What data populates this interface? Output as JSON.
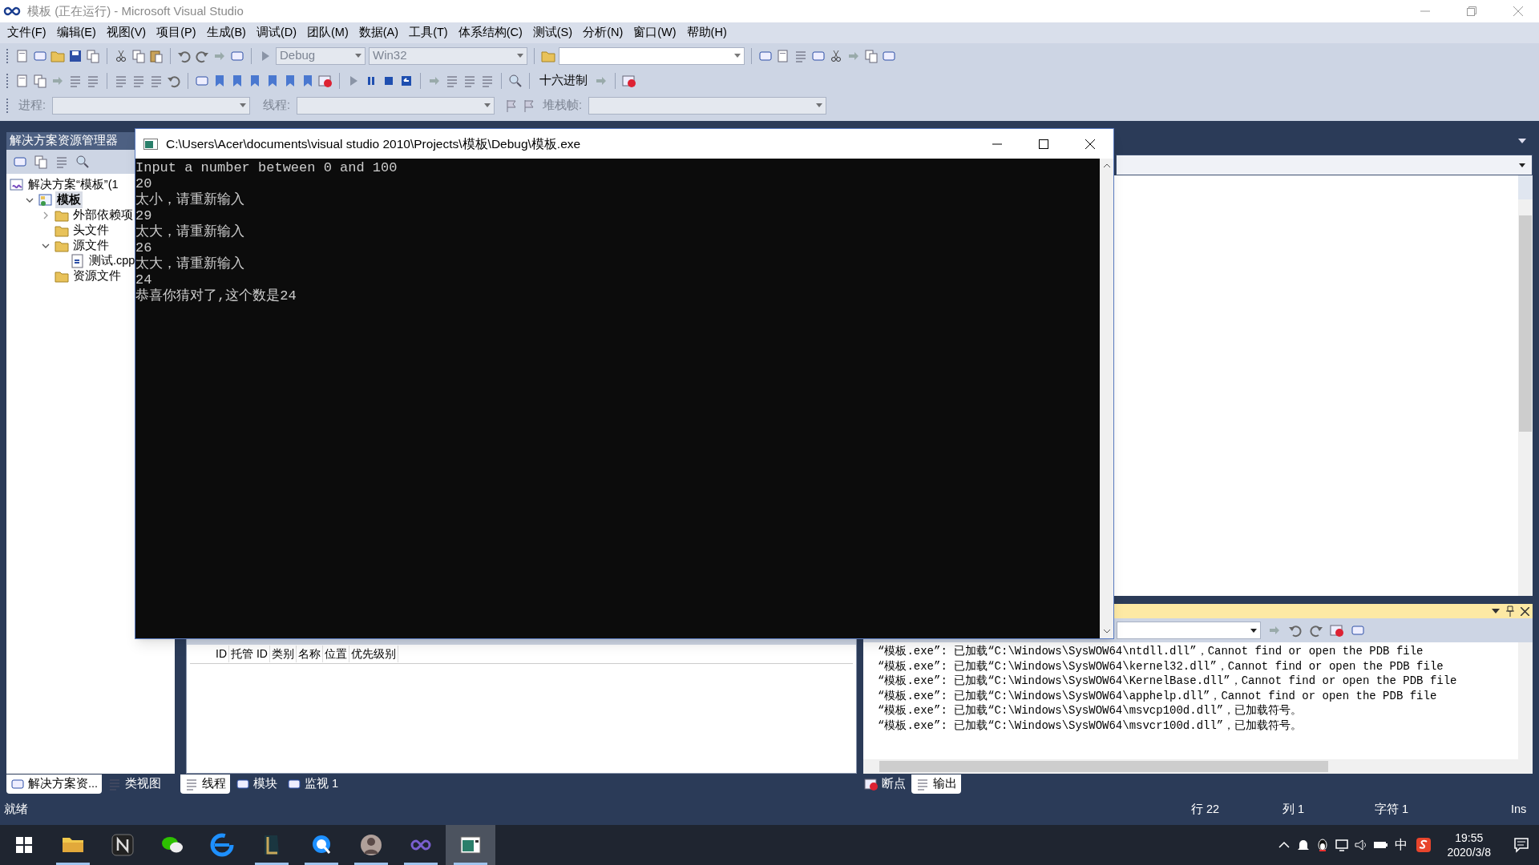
{
  "window": {
    "title": "模板 (正在运行) - Microsoft Visual Studio"
  },
  "menu": [
    "文件(F)",
    "编辑(E)",
    "视图(V)",
    "项目(P)",
    "生成(B)",
    "调试(D)",
    "团队(M)",
    "数据(A)",
    "工具(T)",
    "体系结构(C)",
    "测试(S)",
    "分析(N)",
    "窗口(W)",
    "帮助(H)"
  ],
  "toolbar": {
    "configuration": "Debug",
    "platform": "Win32",
    "hex_button": "十六进制",
    "process_label": "进程:",
    "thread_label": "线程:",
    "stack_frame_label": "堆栈帧:"
  },
  "solution_explorer": {
    "title": "解决方案资源管理器",
    "tree": [
      {
        "label": "解决方案“模板”(1",
        "kind": "solution",
        "selected": false,
        "children": [
          {
            "label": "模板",
            "kind": "project",
            "selected": true,
            "expanded": true,
            "children": [
              {
                "label": "外部依赖项",
                "kind": "folder",
                "selected": false,
                "expanded": false
              },
              {
                "label": "头文件",
                "kind": "folder",
                "selected": false
              },
              {
                "label": "源文件",
                "kind": "folder",
                "selected": false,
                "expanded": true,
                "children": [
                  {
                    "label": "测试.cpp",
                    "kind": "file",
                    "selected": false
                  }
                ]
              },
              {
                "label": "资源文件",
                "kind": "folder",
                "selected": false
              }
            ]
          }
        ]
      }
    ]
  },
  "console": {
    "title": "C:\\Users\\Acer\\documents\\visual studio 2010\\Projects\\模板\\Debug\\模板.exe",
    "lines": [
      "Input a number between 0 and 100",
      "20",
      "太小，请重新输入",
      "29",
      "太大，请重新输入",
      "26",
      "太大，请重新输入",
      "24",
      "恭喜你猜对了,这个数是24"
    ]
  },
  "threads": {
    "columns": [
      "ID",
      "托管 ID",
      "类别",
      "名称",
      "位置",
      "优先级别"
    ]
  },
  "output": {
    "lines": [
      "“模板.exe”: 已加载“C:\\Windows\\SysWOW64\\ntdll.dll”，Cannot find or open the PDB file",
      "“模板.exe”: 已加载“C:\\Windows\\SysWOW64\\kernel32.dll”，Cannot find or open the PDB file",
      "“模板.exe”: 已加载“C:\\Windows\\SysWOW64\\KernelBase.dll”，Cannot find or open the PDB file",
      "“模板.exe”: 已加载“C:\\Windows\\SysWOW64\\apphelp.dll”，Cannot find or open the PDB file",
      "“模板.exe”: 已加载“C:\\Windows\\SysWOW64\\msvcp100d.dll”，已加载符号。",
      "“模板.exe”: 已加载“C:\\Windows\\SysWOW64\\msvcr100d.dll”，已加载符号。"
    ]
  },
  "bottom_tabs": {
    "left": [
      {
        "label": "解决方案资...",
        "selected": true
      },
      {
        "label": "类视图",
        "selected": false
      }
    ],
    "middle": [
      {
        "label": "线程",
        "selected": true
      },
      {
        "label": "模块",
        "selected": false
      },
      {
        "label": "监视 1",
        "selected": false
      }
    ],
    "right": [
      {
        "label": "断点",
        "selected": false
      },
      {
        "label": "输出",
        "selected": true
      }
    ]
  },
  "status_bar": {
    "message": "就绪",
    "line": "行 22",
    "column": "列 1",
    "char": "字符 1",
    "mode": "Ins"
  },
  "taskbar": {
    "apps": [
      {
        "kind": "explorer",
        "running": true,
        "selected": false
      },
      {
        "kind": "notes",
        "running": false,
        "selected": false
      },
      {
        "kind": "chat",
        "running": false,
        "selected": false
      },
      {
        "kind": "browser",
        "running": false,
        "selected": false
      },
      {
        "kind": "game",
        "running": true,
        "selected": false
      },
      {
        "kind": "search",
        "running": true,
        "selected": false
      },
      {
        "kind": "avatar",
        "running": true,
        "selected": false
      },
      {
        "kind": "ide",
        "running": true,
        "selected": false
      },
      {
        "kind": "console",
        "running": true,
        "selected": true
      }
    ],
    "ime": "中",
    "time": "19:55",
    "date": "2020/3/8"
  }
}
